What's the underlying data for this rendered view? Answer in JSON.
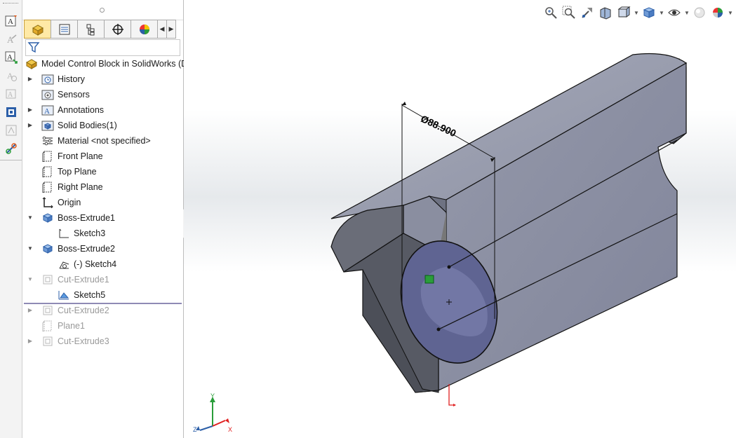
{
  "left_toolbar": {
    "buttons": [
      {
        "icon": "smart-dimension-text-icon"
      },
      {
        "icon": "note-text-icon"
      },
      {
        "icon": "linear-note-icon"
      },
      {
        "icon": "balloon-icon"
      },
      {
        "icon": "auto-balloon-icon"
      },
      {
        "icon": "surface-finish-icon"
      },
      {
        "icon": "weld-symbol-icon"
      },
      {
        "icon": "tolerance-tools-icon"
      }
    ]
  },
  "feature_manager": {
    "tabs": [
      {
        "icon": "feature-manager-tab-icon",
        "active": true
      },
      {
        "icon": "property-manager-tab-icon"
      },
      {
        "icon": "configuration-manager-tab-icon"
      },
      {
        "icon": "dimxpert-manager-tab-icon"
      },
      {
        "icon": "display-manager-tab-icon"
      }
    ],
    "tab_arrows": [
      "◀",
      "▶"
    ],
    "root_label": "Model Control Block in SolidWorks  (D",
    "items": [
      {
        "label": "History",
        "expandable": true,
        "icon": "history-folder-icon"
      },
      {
        "label": "Sensors",
        "expandable": false,
        "icon": "sensors-folder-icon"
      },
      {
        "label": "Annotations",
        "expandable": true,
        "icon": "annotations-folder-icon"
      },
      {
        "label": "Solid Bodies(1)",
        "expandable": true,
        "icon": "solid-bodies-folder-icon"
      },
      {
        "label": "Material <not specified>",
        "expandable": false,
        "icon": "material-icon"
      },
      {
        "label": "Front Plane",
        "expandable": false,
        "icon": "plane-icon"
      },
      {
        "label": "Top Plane",
        "expandable": false,
        "icon": "plane-icon"
      },
      {
        "label": "Right Plane",
        "expandable": false,
        "icon": "plane-icon"
      },
      {
        "label": "Origin",
        "expandable": false,
        "icon": "origin-icon"
      },
      {
        "label": "Boss-Extrude1",
        "expandable": true,
        "expanded": true,
        "icon": "boss-extrude-icon"
      },
      {
        "label": "Sketch3",
        "child": true,
        "icon": "sketch-icon"
      },
      {
        "label": "Boss-Extrude2",
        "expandable": true,
        "expanded": true,
        "icon": "boss-extrude-icon"
      },
      {
        "label": "(-) Sketch4",
        "child": true,
        "icon": "sketch-icon"
      },
      {
        "label": "Cut-Extrude1",
        "expandable": true,
        "expanded": true,
        "dim": true,
        "icon": "cut-extrude-icon"
      },
      {
        "label": "Sketch5",
        "child": true,
        "icon": "sketch-icon"
      },
      {
        "label": "Cut-Extrude2",
        "expandable": true,
        "dim": true,
        "icon": "cut-extrude-icon"
      },
      {
        "label": "Plane1",
        "expandable": false,
        "dim": true,
        "icon": "plane-icon"
      },
      {
        "label": "Cut-Extrude3",
        "expandable": true,
        "dim": true,
        "icon": "cut-extrude-icon"
      }
    ]
  },
  "viewport": {
    "dimension_label": "Ø88.900",
    "heads_up_toolbar": [
      {
        "icon": "zoom-to-fit-icon"
      },
      {
        "icon": "zoom-to-area-icon"
      },
      {
        "icon": "previous-view-icon"
      },
      {
        "icon": "section-view-icon"
      },
      {
        "icon": "view-orientation-icon",
        "dropdown": true
      },
      {
        "icon": "display-style-icon",
        "dropdown": true
      },
      {
        "icon": "hide-show-items-icon",
        "dropdown": true
      },
      {
        "icon": "edit-appearance-icon"
      },
      {
        "icon": "apply-scene-icon",
        "dropdown": true
      }
    ],
    "triad_labels": {
      "x": "X",
      "y": "Y",
      "z": "Z"
    }
  },
  "colors": {
    "model_face_light": "#a2a6b7",
    "model_face_mid": "#8b8fa2",
    "model_face_dark": "#5b5e69",
    "hole_fill": "#5f6492",
    "sketch_green": "#2a9d3a",
    "active_tab": "#ffe9a6"
  }
}
